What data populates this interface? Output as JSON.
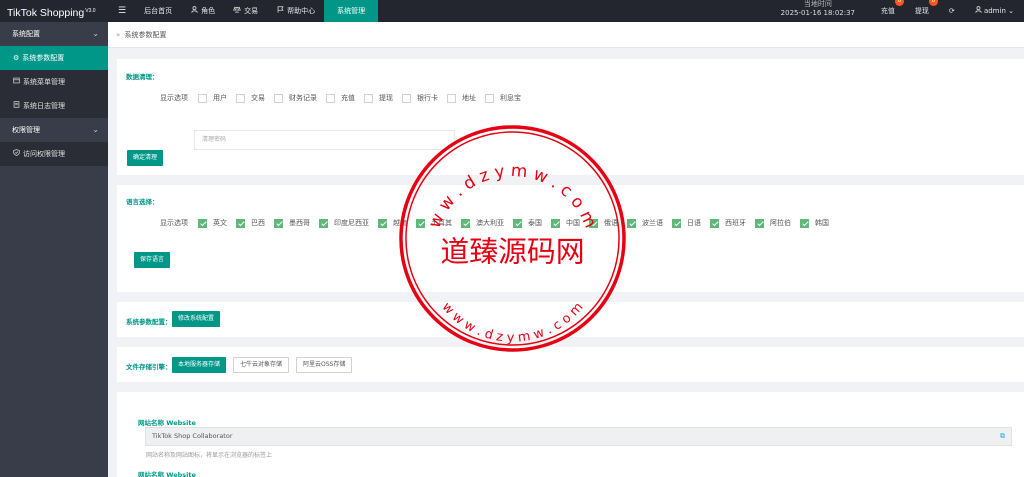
{
  "app": {
    "brand": "TikTok Shopping",
    "version": "V3.0"
  },
  "nav": {
    "toggle_icon": "menu-icon",
    "items": [
      {
        "label": "后台首页",
        "icon": ""
      },
      {
        "label": "角色",
        "icon": "user-icon"
      },
      {
        "label": "交易",
        "icon": "scale-icon"
      },
      {
        "label": "帮助中心",
        "icon": "flag-icon"
      },
      {
        "label": "系统管理",
        "icon": ""
      }
    ]
  },
  "topright": {
    "time_label": "当地时间",
    "time_value": "2025-01-16 18:02:37",
    "recharge_label": "充值",
    "recharge_badge": "0",
    "withdraw_label": "提现",
    "withdraw_badge": "0",
    "refresh_icon": "refresh-icon",
    "user_name": "admin"
  },
  "sidebar": {
    "groups": [
      {
        "label": "系统配置"
      },
      {
        "label": "权限管理"
      }
    ],
    "items": [
      {
        "label": "系统参数配置",
        "icon": "gear-icon"
      },
      {
        "label": "系统菜单管理",
        "icon": "menu-list-icon"
      },
      {
        "label": "系统日志管理",
        "icon": "log-icon"
      },
      {
        "label": "访问权限管理",
        "icon": "shield-check-icon"
      }
    ]
  },
  "breadcrumb": {
    "sep": "»",
    "current": "系统参数配置"
  },
  "data_clean": {
    "title": "数据清理：",
    "row_label": "显示选项",
    "options": [
      "用户",
      "交易",
      "财务记录",
      "充值",
      "提现",
      "银行卡",
      "地址",
      "利息宝"
    ],
    "password_placeholder": "清理密码",
    "button": "确定清理"
  },
  "language": {
    "title": "语言选择：",
    "row_label": "显示选项",
    "options": [
      "英文",
      "巴西",
      "墨西哥",
      "印度尼西亚",
      "越南",
      "土耳其",
      "澳大利亚",
      "泰国",
      "中国",
      "俄语",
      "波兰语",
      "日语",
      "西班牙",
      "阿拉伯",
      "韩国"
    ],
    "button": "保存语言"
  },
  "sys_params": {
    "title": "系统参数配置：",
    "button": "修改系统配置"
  },
  "storage": {
    "title": "文件存储引擎：",
    "buttons": [
      "本地服务器存储",
      "七牛云对象存储",
      "阿里云OSS存储"
    ]
  },
  "website": {
    "label": "网站名称 Website",
    "value": "TikTok Shop Collaborator",
    "hint": "网站名称及网站图标，将显示在浏览器的标签上",
    "label2": "网站名称 Website",
    "edit_icon": "edit-icon"
  },
  "watermark": {
    "center_text": "道臻源码网",
    "top_arc": "w w . d z y m w . c o m",
    "bottom_arc": "w w w . d z y m w . c o m",
    "color": "#e60012"
  }
}
